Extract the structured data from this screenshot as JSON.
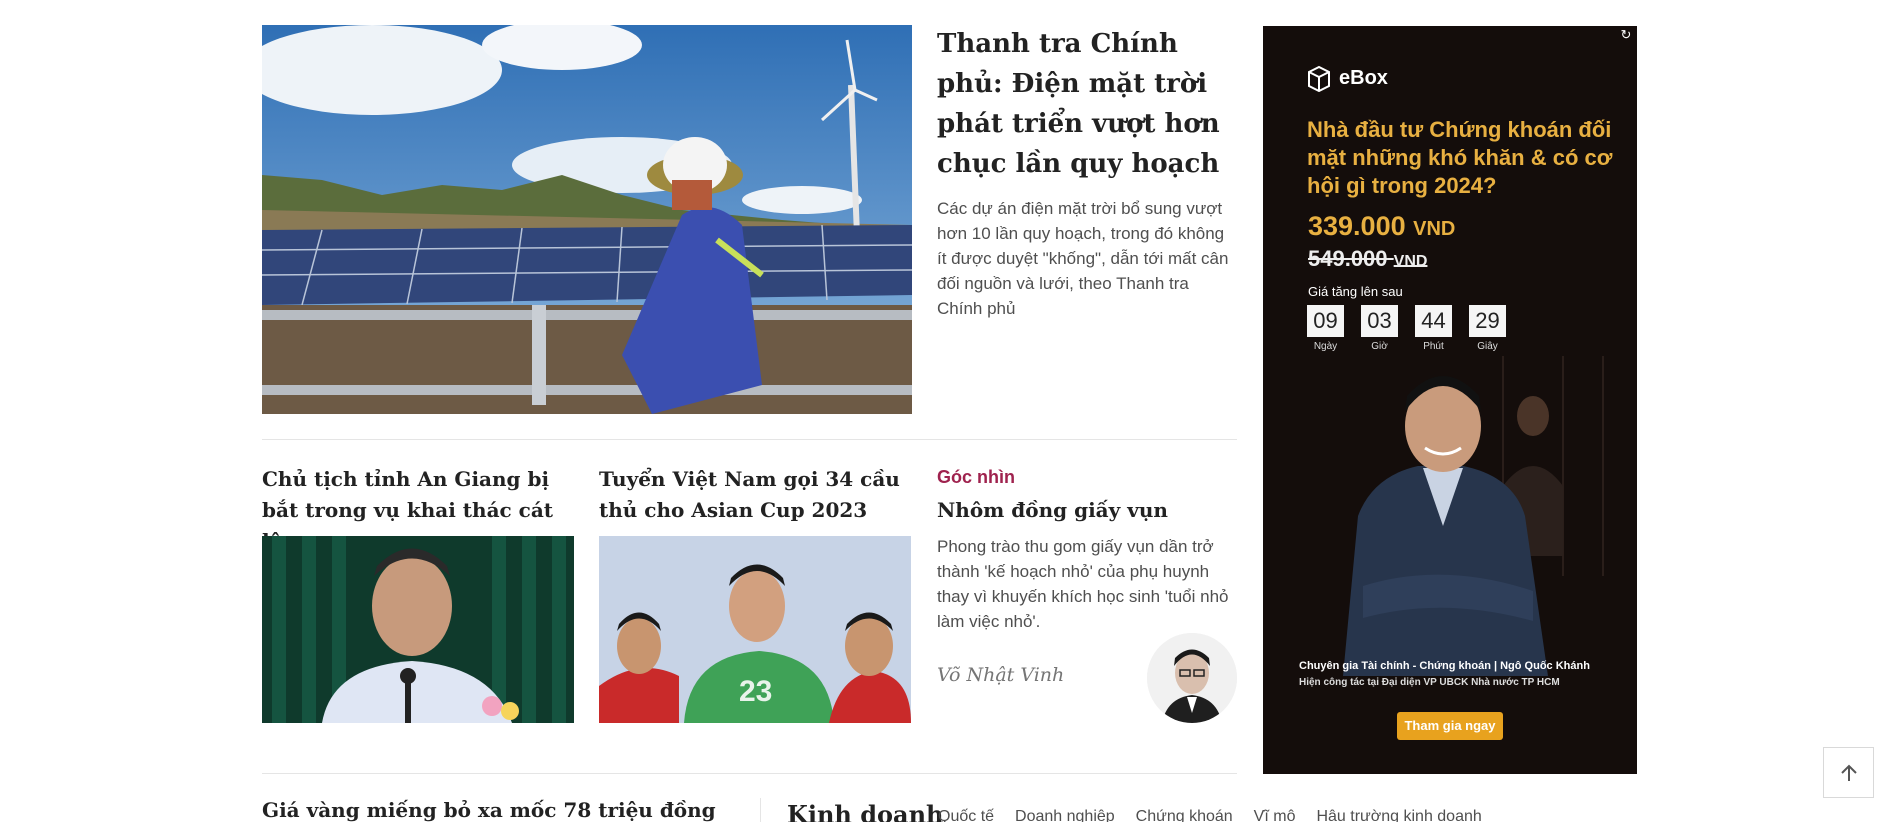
{
  "featured": {
    "title": "Thanh tra Chính phủ: Điện mặt trời phát triển vượt hơn chục lần quy hoạch",
    "description": "Các dự án điện mặt trời bổ sung vượt hơn 10 lần quy hoạch, trong đó không ít được duyệt \"khống\", dẫn tới mất cân đối nguồn và lưới, theo Thanh tra Chính phủ"
  },
  "sub_articles": [
    {
      "title": "Chủ tịch tỉnh An Giang bị bắt trong vụ khai thác cát lậu"
    },
    {
      "title": "Tuyển Việt Nam gọi 34 cầu thủ cho Asian Cup 2023"
    }
  ],
  "opinion": {
    "category": "Góc nhìn",
    "title": "Nhôm đồng giấy vụn",
    "description": "Phong trào thu gom giấy vụn dần trở thành 'kế hoạch nhỏ' của phụ huynh thay vì khuyến khích học sinh 'tuổi nhỏ làm việc nhỏ'.",
    "author": "Võ Nhật Vinh"
  },
  "bottom": {
    "article_title": "Giá vàng miếng bỏ xa mốc 78 triệu đồng",
    "section_title": "Kinh doanh",
    "section_links": [
      "Quốc tế",
      "Doanh nghiệp",
      "Chứng khoán",
      "Vĩ mô",
      "Hậu trường kinh doanh"
    ]
  },
  "ad": {
    "brand": "eBox",
    "headline": "Nhà đầu tư Chứng khoán đối mặt những khó khăn & có cơ hội gì trong 2024?",
    "price": "339.000",
    "old_price": "549.000",
    "currency": "VND",
    "rise_label": "Giá tăng lên sau",
    "countdown": [
      {
        "value": "09",
        "label": "Ngày"
      },
      {
        "value": "03",
        "label": "Giờ"
      },
      {
        "value": "44",
        "label": "Phút"
      },
      {
        "value": "29",
        "label": "Giây"
      }
    ],
    "caption_line1": "Chuyên gia Tài chính - Chứng khoán  |  Ngô Quốc Khánh",
    "caption_line2": "Hiện công tác tại Đại diện VP UBCK Nhà nước TP HCM",
    "cta": "Tham gia ngay"
  },
  "colors": {
    "opinion_category": "#9f224e",
    "ad_background": "#140d0b",
    "ad_accent": "#e8b041",
    "ad_button": "#e8a21e"
  }
}
